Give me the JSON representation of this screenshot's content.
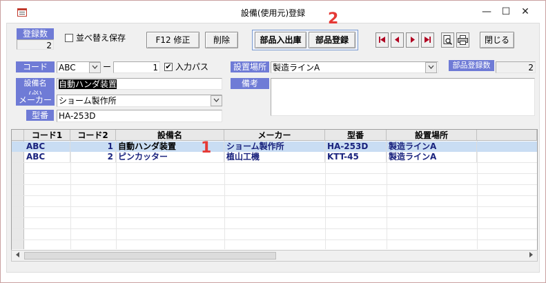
{
  "window": {
    "title": "設備(使用元)登録",
    "minimize": "—",
    "maximize": "☐",
    "close": "✕"
  },
  "toolbar": {
    "count_label": "登録数",
    "count_value": "2",
    "sort_save_label": "並べ替え保存",
    "f12_label": "F12 修正",
    "delete_label": "削除",
    "parts_io_label": "部品入出庫",
    "parts_reg_label": "部品登録",
    "close_label": "閉じる"
  },
  "form": {
    "code_label": "コード",
    "code_value": "ABC",
    "code_dash": "ー",
    "code_num": "1",
    "input_pass_label": "入力パス",
    "name_label": "設備名(必)",
    "name_value": "自動ハンダ装置",
    "maker_label": "メーカー",
    "maker_value": "ショーム製作所",
    "model_label": "型番",
    "model_value": "HA-253D",
    "location_label": "設置場所",
    "location_value": "製造ラインA",
    "notes_label": "備考",
    "parts_count_label": "部品登録数",
    "parts_count_value": "2"
  },
  "grid": {
    "headers": [
      "コード1",
      "コード2",
      "設備名",
      "メーカー",
      "型番",
      "設置場所"
    ],
    "rows": [
      [
        "ABC",
        "1",
        "自動ハンダ装置",
        "ショーム製作所",
        "HA-253D",
        "製造ラインA"
      ],
      [
        "ABC",
        "2",
        "ピンカッター",
        "植山工機",
        "KTT-45",
        "製造ラインA"
      ]
    ]
  },
  "annotations": {
    "one": "1",
    "two": "2"
  },
  "colors": {
    "label_bg": "#6f7bd6",
    "selected_row": "#c9ddf3",
    "grid_text": "#1a237e",
    "annotation": "#e53935"
  }
}
